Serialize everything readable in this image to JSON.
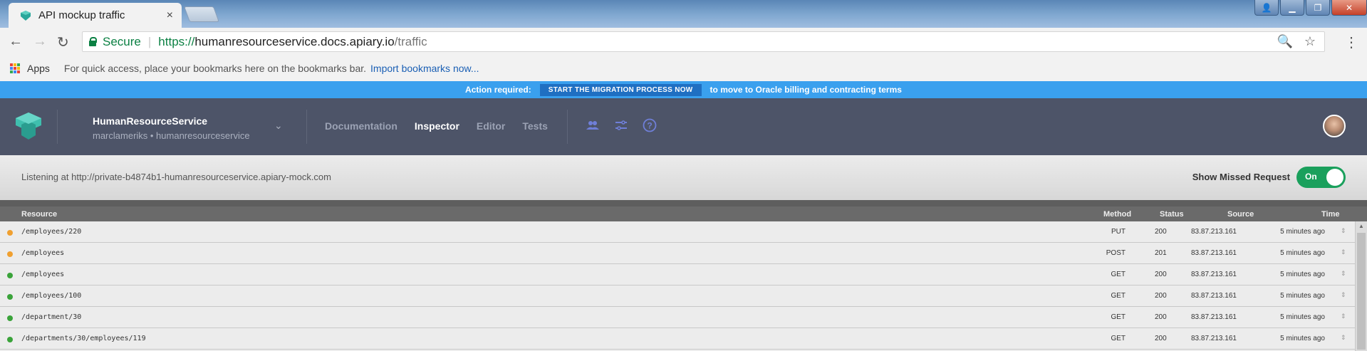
{
  "browser": {
    "tab_title": "API mockup traffic",
    "tab_close": "×",
    "address": {
      "secure_label": "Secure",
      "url_scheme": "https://",
      "url_host": "humanresourceservice.docs.apiary.io",
      "url_path": "/traffic"
    },
    "bookmarks": {
      "apps_label": "Apps",
      "prompt": "For quick access, place your bookmarks here on the bookmarks bar.",
      "import_link": "Import bookmarks now..."
    }
  },
  "banner": {
    "label": "Action required:",
    "button": "START THE MIGRATION PROCESS NOW",
    "message": "to move to Oracle billing and contracting terms"
  },
  "header": {
    "project_name": "HumanResourceService",
    "project_sub": "marclameriks • humanresourceservice",
    "nav": [
      "Documentation",
      "Inspector",
      "Editor",
      "Tests"
    ],
    "active_nav": "Inspector"
  },
  "listening": {
    "text": "Listening at http://private-b4874b1-humanresourceservice.apiary-mock.com",
    "missed_label": "Show Missed Request",
    "toggle_label": "On"
  },
  "table": {
    "columns": [
      "Resource",
      "Method",
      "Status",
      "Source",
      "Time"
    ],
    "rows": [
      {
        "resource": "/employees/220",
        "method": "PUT",
        "status": "200",
        "source": "83.87.213.161",
        "time": "5 minutes ago",
        "dot": "#f0a030"
      },
      {
        "resource": "/employees",
        "method": "POST",
        "status": "201",
        "source": "83.87.213.161",
        "time": "5 minutes ago",
        "dot": "#f0a030"
      },
      {
        "resource": "/employees",
        "method": "GET",
        "status": "200",
        "source": "83.87.213.161",
        "time": "5 minutes ago",
        "dot": "#3aa33a"
      },
      {
        "resource": "/employees/100",
        "method": "GET",
        "status": "200",
        "source": "83.87.213.161",
        "time": "5 minutes ago",
        "dot": "#3aa33a"
      },
      {
        "resource": "/department/30",
        "method": "GET",
        "status": "200",
        "source": "83.87.213.161",
        "time": "5 minutes ago",
        "dot": "#3aa33a"
      },
      {
        "resource": "/departments/30/employees/119",
        "method": "GET",
        "status": "200",
        "source": "83.87.213.161",
        "time": "5 minutes ago",
        "dot": "#3aa33a"
      }
    ]
  },
  "colors": {
    "banner": "#3aa0ee",
    "header": "#4d5468",
    "toggle_on": "#1aa05c",
    "secure": "#0b8043"
  }
}
